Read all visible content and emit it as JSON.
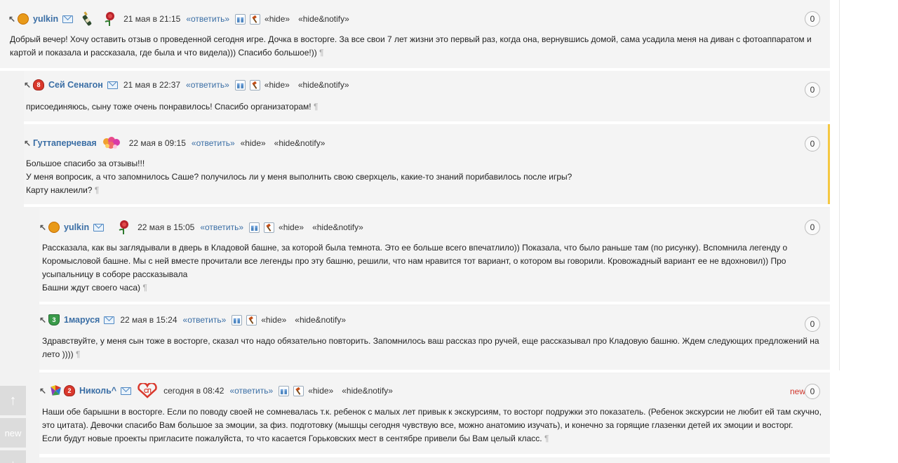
{
  "labels": {
    "reply": "«ответить»",
    "hide": "«hide»",
    "hide_notify": "«hide&notify»",
    "pilcrow": "¶",
    "new": "new"
  },
  "comments": [
    {
      "user": "yulkin",
      "time": "21 мая в 21:15",
      "count": "0",
      "text": [
        "Добрый вечер! Хочу оставить отзыв о проведенной сегодня игре. Дочка в восторге. За все свои 7 лет жизни это первый раз, когда она, вернувшись домой, сама усадила меня на диван с фотоаппаратом и",
        "картой и показала и рассказала, где была и что видела))) Спасибо большое!))"
      ]
    },
    {
      "user": "Сей Сенагон",
      "time": "21 мая в 22:37",
      "count": "0",
      "text": [
        "присоединяюсь, сыну тоже очень понравилось! Спасибо организаторам!"
      ]
    },
    {
      "user": "Гуттаперчевая",
      "time": "22 мая в 09:15",
      "count": "0",
      "text": [
        "Большое спасибо за отзывы!!!",
        "У меня вопросик, а что запомнилось Саше? получилось ли у меня выполнить свою сверхцель, какие-то знаний порибавилось после игры?",
        "Карту наклеили?"
      ]
    },
    {
      "user": "yulkin",
      "time": "22 мая в 15:05",
      "count": "0",
      "text": [
        "Рассказала, как вы заглядывали в дверь в Кладовой башне, за которой была темнота. Это ее больше всего впечатлило)) Показала, что было раньше там (по рисунку). Вспомнила легенду о",
        "Коромысловой башне. Мы с ней вместе прочитали все легенды про эту башню, решили, что нам нравится тот вариант, о котором вы говорили. Кровожадный вариант ее не вдохновил)) Про",
        "усыпальницу в соборе рассказывала",
        "Башни ждут своего часа)"
      ]
    },
    {
      "user": "1маруся",
      "time": "22 мая в 15:24",
      "count": "0",
      "text": [
        "Здравствуйте, у меня сын тоже в восторге, сказал что надо обязательно повторить. Запомнилось ваш рассказ про ручей, еще рассказывал про Кладовую башню. Ждем следующих предложений на",
        "лето ))))"
      ]
    },
    {
      "user": "Николь^",
      "time": "сегодня в 08:42",
      "count": "0",
      "text": [
        "Наши обе барышни в восторге. Если по поводу своей не сомневалась т.к. ребенок с малых лет привык к экскурсиям, то восторг подружки это показатель. (Ребенок экскурсии не любит ей там скучно,",
        "это цитата). Девочки спасибо Вам большое за эмоции, за физ. подготовку (мышцы сегодня чувствую все, можно анатомию изучать), и конечно за горящие глазенки детей их эмоции и восторг.",
        "Если будут новые проекты пригласите пожалуйста, то что касается Горьковских мест в сентябре привели бы Вам целый класс."
      ]
    }
  ],
  "badges": {
    "c1": "",
    "c2": "8",
    "c5": "3",
    "c6": "2"
  },
  "side": {
    "up": "↑",
    "new": "new",
    "down": "↓"
  },
  "colors": {
    "link": "#3a6ea5",
    "new": "#d0352b",
    "highlight": "#f5c842"
  }
}
